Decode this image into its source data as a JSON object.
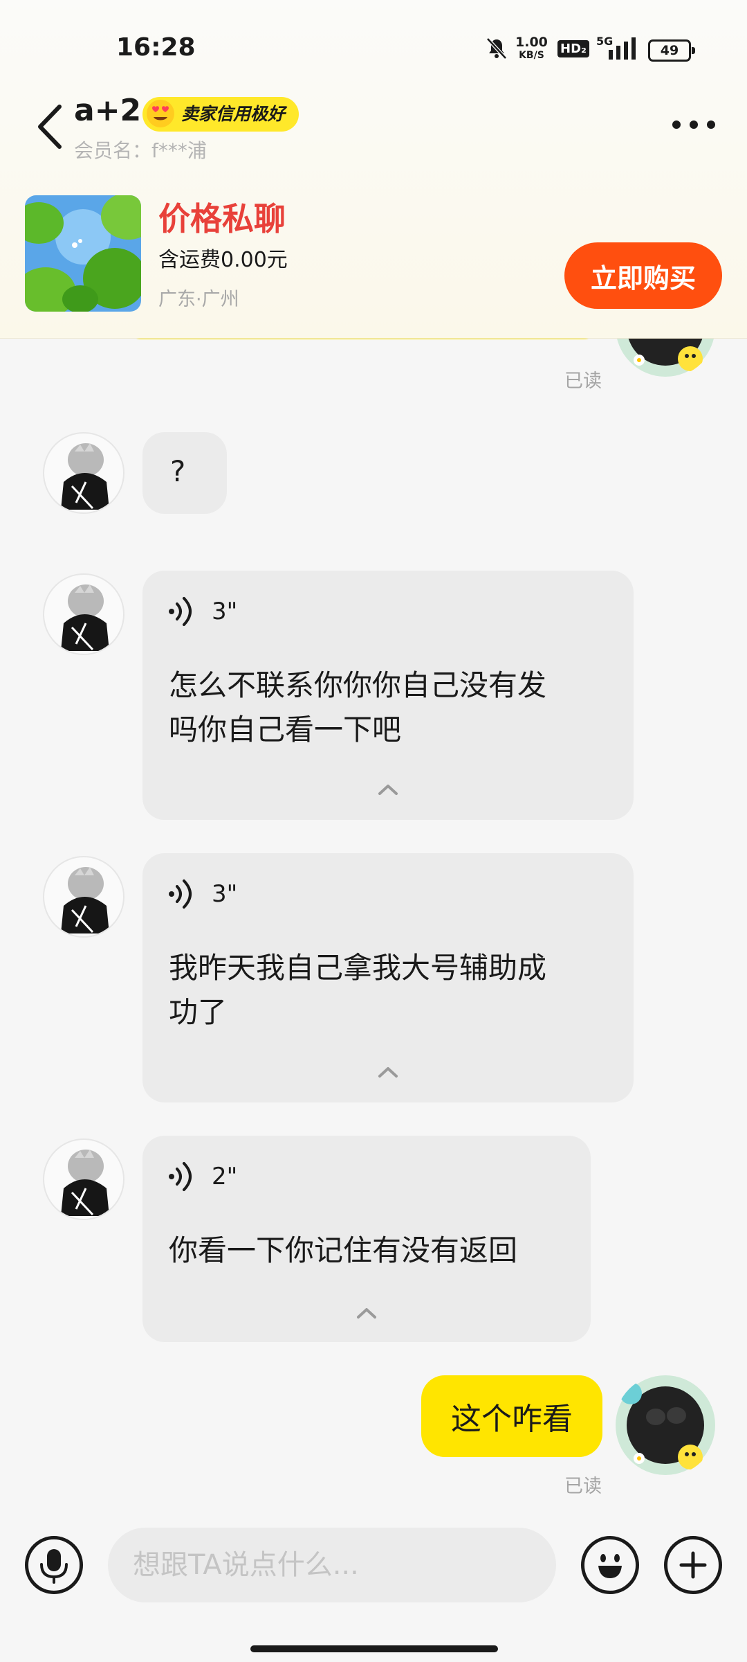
{
  "status_bar": {
    "time": "16:28",
    "network_speed_value": "1.00",
    "network_speed_unit": "KB/S",
    "hd_label": "HD₂",
    "network_type": "5G",
    "battery": "49"
  },
  "header": {
    "title": "a+2",
    "badge": "卖家信用极好",
    "member_label": "会员名：f***浦"
  },
  "product": {
    "price": "价格私聊",
    "shipping": "含运费0.00元",
    "location": "广东·广州",
    "buy_button": "立即购买"
  },
  "messages": [
    {
      "side": "out",
      "read_label": "已读"
    },
    {
      "side": "in",
      "text": "?"
    },
    {
      "side": "in",
      "type": "voice",
      "duration": "3\"",
      "transcript_line1": "怎么不联系你你你自己没有发",
      "transcript_line2": "吗你自己看一下吧"
    },
    {
      "side": "in",
      "type": "voice",
      "duration": "3\"",
      "transcript_line1": "我昨天我自己拿我大号辅助成",
      "transcript_line2": "功了"
    },
    {
      "side": "in",
      "type": "voice",
      "duration": "2\"",
      "transcript_line1": "你看一下你记住有没有返回"
    },
    {
      "side": "out",
      "text": "这个咋看",
      "read_label": "已读"
    }
  ],
  "composer": {
    "placeholder": "想跟TA说点什么..."
  },
  "colors": {
    "accent_yellow": "#ffe500",
    "buy_orange": "#ff4f0f",
    "price_red": "#e8413a",
    "incoming_bubble": "#ebebeb"
  }
}
